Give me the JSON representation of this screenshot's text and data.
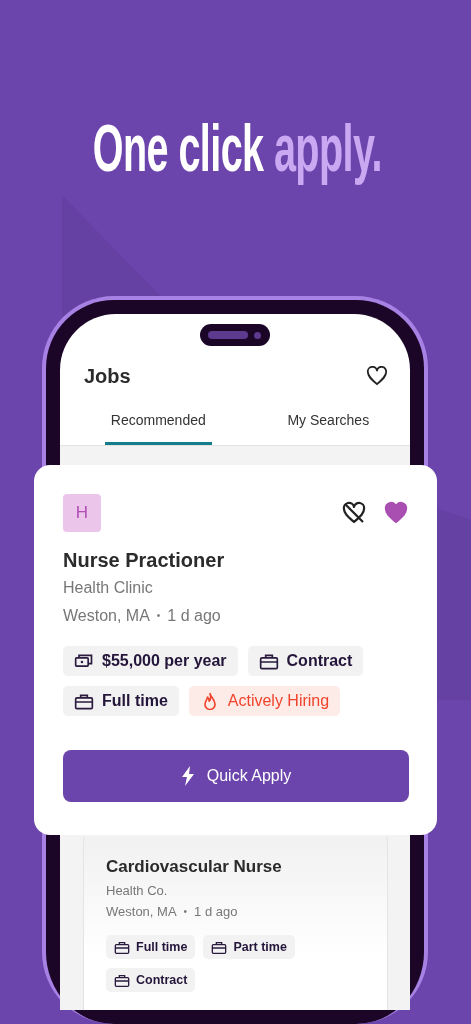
{
  "headline": {
    "lead": "One click",
    "accent": "apply."
  },
  "app": {
    "title": "Jobs",
    "tabs": [
      {
        "label": "Recommended",
        "selected": true
      },
      {
        "label": "My Searches",
        "selected": false
      }
    ]
  },
  "featured_job": {
    "logo_letter": "H",
    "saved": true,
    "title": "Nurse Practioner",
    "company": "Health Clinic",
    "location": "Weston, MA",
    "separator": "•",
    "posted": "1 d ago",
    "tags": [
      {
        "kind": "salary",
        "label": "$55,000 per year"
      },
      {
        "kind": "type",
        "label": "Contract"
      },
      {
        "kind": "type",
        "label": "Full time"
      },
      {
        "kind": "hiring",
        "label": "Actively Hiring"
      }
    ],
    "button": "Quick Apply"
  },
  "job_list": [
    {
      "title": "Cardiovascular Nurse",
      "company": "Health Co.",
      "location": "Weston, MA",
      "separator": "•",
      "posted": "1 d ago",
      "tags": [
        {
          "kind": "type",
          "label": "Full time"
        },
        {
          "kind": "type",
          "label": "Part time"
        },
        {
          "kind": "type",
          "label": "Contract"
        }
      ]
    }
  ]
}
